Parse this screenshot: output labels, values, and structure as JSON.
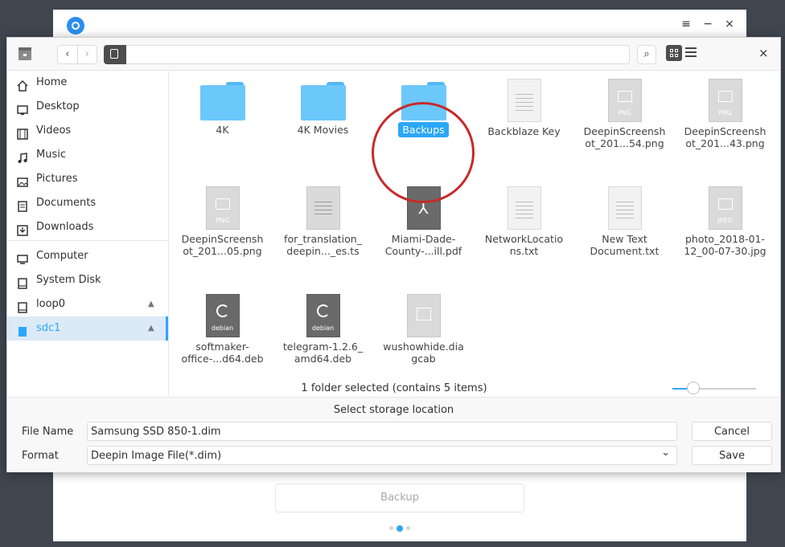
{
  "background_window": {
    "menu_icon": "≡",
    "minimize_icon": "−",
    "close_icon": "×",
    "backup_button": "Backup",
    "page_indicator": {
      "pages": 3,
      "active": 2
    }
  },
  "toolbar": {
    "back": "‹",
    "forward": "›",
    "search_icon": "⌕",
    "close": "×"
  },
  "sidebar": {
    "items": [
      {
        "label": "Home",
        "icon": "home-icon"
      },
      {
        "label": "Desktop",
        "icon": "desktop-icon"
      },
      {
        "label": "Videos",
        "icon": "videos-icon"
      },
      {
        "label": "Music",
        "icon": "music-icon"
      },
      {
        "label": "Pictures",
        "icon": "pictures-icon"
      },
      {
        "label": "Documents",
        "icon": "documents-icon"
      },
      {
        "label": "Downloads",
        "icon": "downloads-icon"
      },
      {
        "label": "Computer",
        "icon": "computer-icon"
      },
      {
        "label": "System Disk",
        "icon": "disk-icon"
      },
      {
        "label": "loop0",
        "icon": "disk-icon",
        "eject": "▲"
      },
      {
        "label": "sdc1",
        "icon": "disk-icon",
        "eject": "▲",
        "active": true
      }
    ]
  },
  "files": [
    {
      "name": "4K",
      "kind": "folder"
    },
    {
      "name": "4K Movies",
      "kind": "folder"
    },
    {
      "name": "Backups",
      "kind": "folder",
      "selected": true
    },
    {
      "name": "Backblaze Key",
      "kind": "text"
    },
    {
      "name": "DeepinScreensh ot_201...54.png",
      "kind": "png",
      "tag": "PNG"
    },
    {
      "name": "DeepinScreensh ot_201...43.png",
      "kind": "png",
      "tag": "PNG"
    },
    {
      "name": "DeepinScreensh ot_201...05.png",
      "kind": "png",
      "tag": "PNG"
    },
    {
      "name": "for_translation_ deepin..._es.ts",
      "kind": "ts"
    },
    {
      "name": "Miami-Dade- County-...ill.pdf",
      "kind": "pdf"
    },
    {
      "name": "NetworkLocatio ns.txt",
      "kind": "text"
    },
    {
      "name": "New Text Document.txt",
      "kind": "text"
    },
    {
      "name": "photo_2018-01- 12_00-07-30.jpg",
      "kind": "png",
      "tag": "JPEG"
    },
    {
      "name": "softmaker- office-...d64.deb",
      "kind": "deb",
      "tag": "debian"
    },
    {
      "name": "telegram-1.2.6_ amd64.deb",
      "kind": "deb",
      "tag": "debian"
    },
    {
      "name": "wushowhide.dia gcab",
      "kind": "cab"
    }
  ],
  "status": "1 folder selected (contains 5 items)",
  "zoom_level": 0.25,
  "bottom": {
    "title": "Select storage location",
    "file_name_label": "File Name",
    "file_name_value": "Samsung SSD 850-1.dim",
    "format_label": "Format",
    "format_value": "Deepin Image File(*.dim)",
    "cancel_button": "Cancel",
    "save_button": "Save"
  },
  "colors": {
    "accent": "#2ca7f8",
    "folder": "#6cc7fb",
    "highlight_circle": "#c62a2a"
  }
}
